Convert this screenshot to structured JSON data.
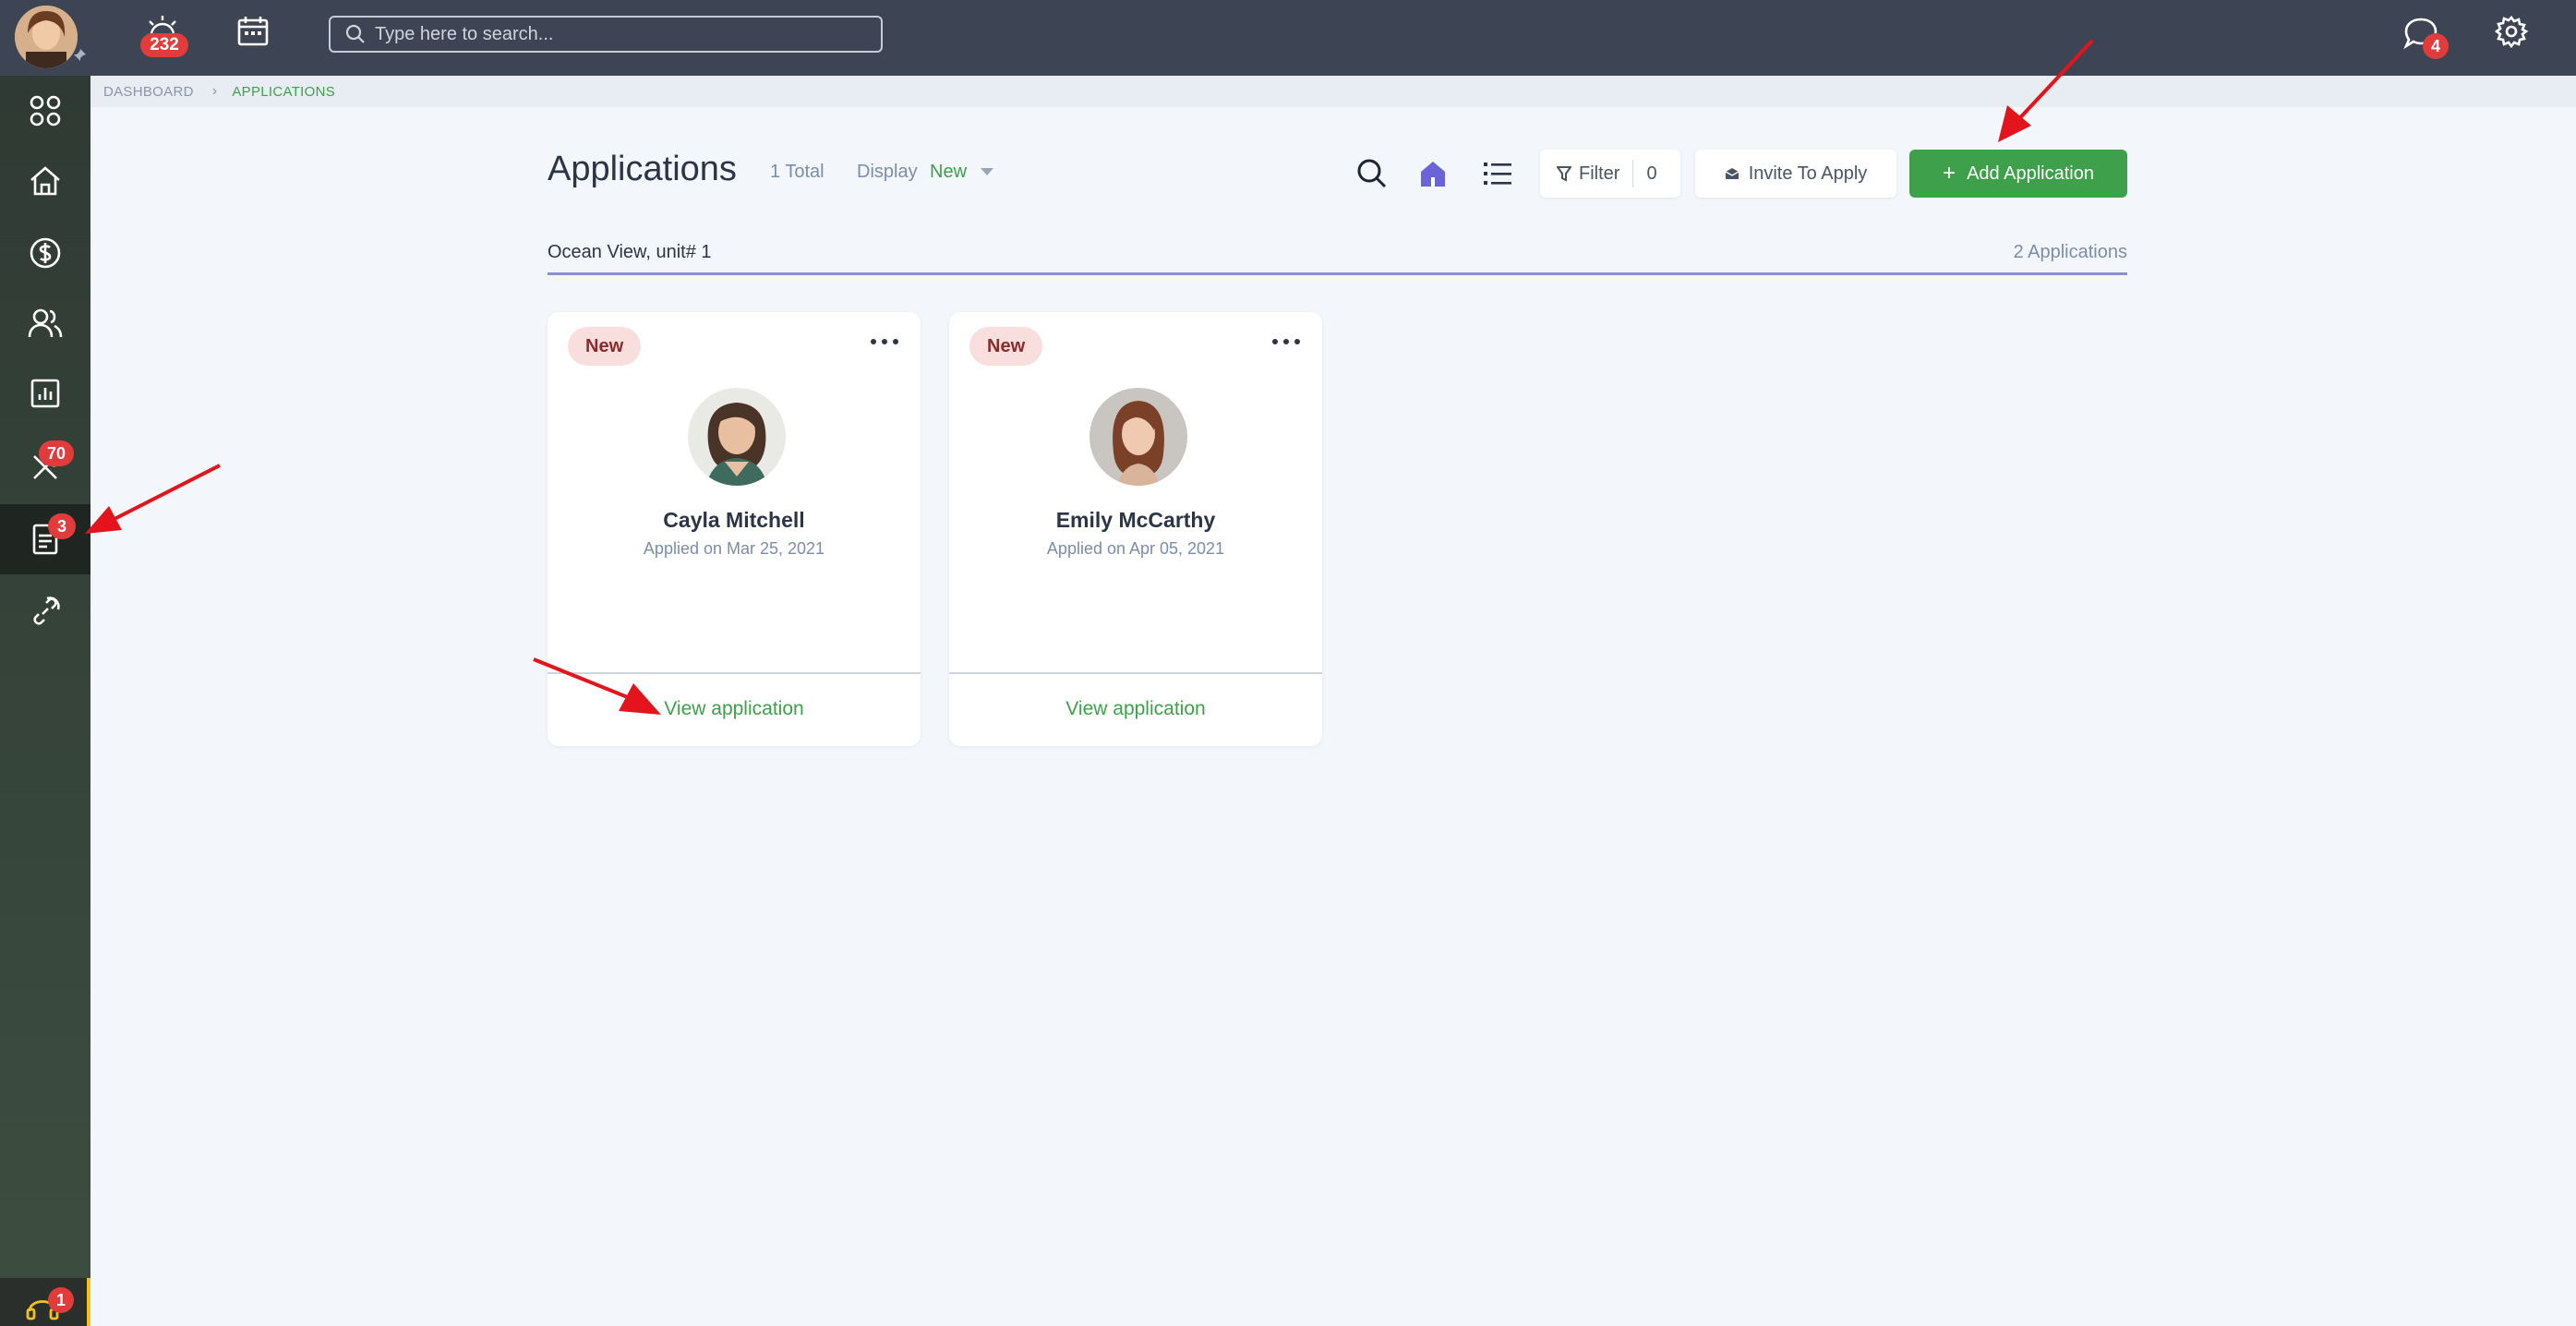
{
  "topbar": {
    "notifications_count": "232",
    "search_placeholder": "Type here to search...",
    "messages_count": "4"
  },
  "sidebar": {
    "maintenance_count": "70",
    "applications_count": "3",
    "support_count": "1"
  },
  "breadcrumb": {
    "root": "DASHBOARD",
    "current": "APPLICATIONS"
  },
  "header": {
    "title": "Applications",
    "total": "1 Total",
    "display_label": "Display",
    "display_value": "New",
    "filter_label": "Filter",
    "filter_count": "0",
    "invite_label": "Invite To Apply",
    "add_label": "Add Application"
  },
  "property": {
    "name": "Ocean View, unit# 1",
    "count": "2 Applications"
  },
  "applications": [
    {
      "status": "New",
      "name": "Cayla Mitchell",
      "applied": "Applied on Mar 25, 2021",
      "action": "View application"
    },
    {
      "status": "New",
      "name": "Emily McCarthy",
      "applied": "Applied on Apr 05, 2021",
      "action": "View application"
    }
  ],
  "colors": {
    "accent_green": "#3ea04a",
    "topbar": "#3d4453",
    "badge_red": "#e23b3b",
    "annotation_red": "#e3141b"
  }
}
